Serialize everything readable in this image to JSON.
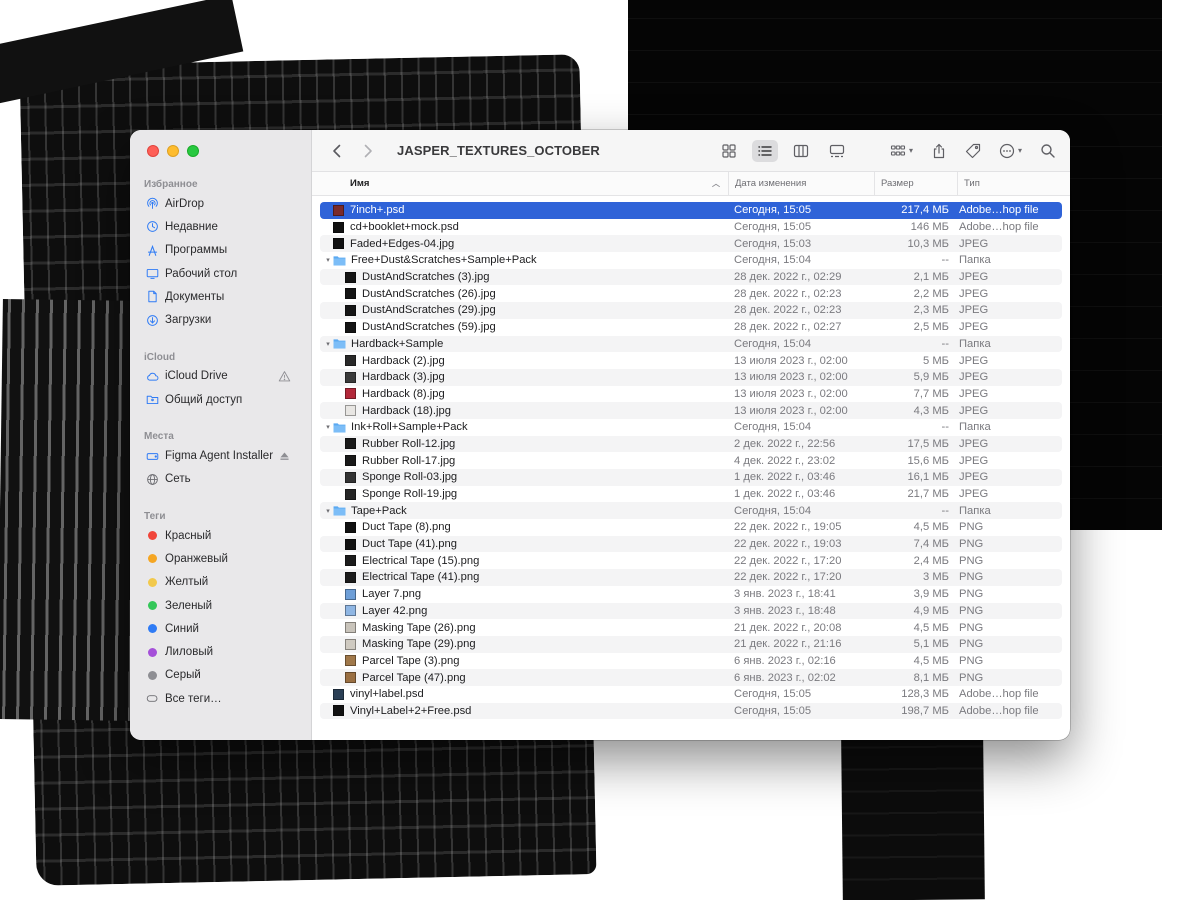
{
  "window": {
    "title": "JASPER_TEXTURES_OCTOBER"
  },
  "sidebar": {
    "sections": [
      {
        "header": "Избранное",
        "items": [
          {
            "label": "AirDrop",
            "icon": "airdrop-icon"
          },
          {
            "label": "Недавние",
            "icon": "clock-icon"
          },
          {
            "label": "Программы",
            "icon": "apps-icon"
          },
          {
            "label": "Рабочий стол",
            "icon": "desktop-icon"
          },
          {
            "label": "Документы",
            "icon": "document-icon"
          },
          {
            "label": "Загрузки",
            "icon": "download-icon"
          }
        ]
      },
      {
        "header": "iCloud",
        "items": [
          {
            "label": "iCloud Drive",
            "icon": "cloud-icon",
            "trailing": "warning-icon"
          },
          {
            "label": "Общий доступ",
            "icon": "shared-folder-icon"
          }
        ]
      },
      {
        "header": "Места",
        "items": [
          {
            "label": "Figma Agent Installer",
            "icon": "drive-icon",
            "trailing": "eject-icon"
          },
          {
            "label": "Сеть",
            "icon": "globe-icon"
          }
        ]
      },
      {
        "header": "Теги",
        "items": [
          {
            "label": "Красный",
            "color": "#f0453a"
          },
          {
            "label": "Оранжевый",
            "color": "#f5a623"
          },
          {
            "label": "Желтый",
            "color": "#f2c94c"
          },
          {
            "label": "Зеленый",
            "color": "#34c759"
          },
          {
            "label": "Синий",
            "color": "#2f7bf5"
          },
          {
            "label": "Лиловый",
            "color": "#a550d9"
          },
          {
            "label": "Серый",
            "color": "#8e8e93"
          },
          {
            "label": "Все теги…",
            "icon": "all-tags-icon"
          }
        ]
      }
    ]
  },
  "columns": {
    "name": "Имя",
    "date": "Дата изменения",
    "size": "Размер",
    "kind": "Тип"
  },
  "files": [
    {
      "name": "7inch+.psd",
      "date": "Сегодня, 15:05",
      "size": "217,4 МБ",
      "kind": "Adobe…hop file",
      "level": 0,
      "type": "file",
      "thumb": "#7a2a2a",
      "selected": true
    },
    {
      "name": "cd+booklet+mock.psd",
      "date": "Сегодня, 15:05",
      "size": "146 МБ",
      "kind": "Adobe…hop file",
      "level": 0,
      "type": "file",
      "thumb": "#111111"
    },
    {
      "name": "Faded+Edges-04.jpg",
      "date": "Сегодня, 15:03",
      "size": "10,3 МБ",
      "kind": "JPEG",
      "level": 0,
      "type": "file",
      "thumb": "#111111"
    },
    {
      "name": "Free+Dust&Scratches+Sample+Pack",
      "date": "Сегодня, 15:04",
      "size": "--",
      "kind": "Папка",
      "level": 0,
      "type": "folder"
    },
    {
      "name": "DustAndScratches (3).jpg",
      "date": "28 дек. 2022 г., 02:29",
      "size": "2,1 МБ",
      "kind": "JPEG",
      "level": 1,
      "type": "file",
      "thumb": "#151515"
    },
    {
      "name": "DustAndScratches (26).jpg",
      "date": "28 дек. 2022 г., 02:23",
      "size": "2,2 МБ",
      "kind": "JPEG",
      "level": 1,
      "type": "file",
      "thumb": "#151515"
    },
    {
      "name": "DustAndScratches (29).jpg",
      "date": "28 дек. 2022 г., 02:23",
      "size": "2,3 МБ",
      "kind": "JPEG",
      "level": 1,
      "type": "file",
      "thumb": "#151515"
    },
    {
      "name": "DustAndScratches (59).jpg",
      "date": "28 дек. 2022 г., 02:27",
      "size": "2,5 МБ",
      "kind": "JPEG",
      "level": 1,
      "type": "file",
      "thumb": "#151515"
    },
    {
      "name": "Hardback+Sample",
      "date": "Сегодня, 15:04",
      "size": "--",
      "kind": "Папка",
      "level": 0,
      "type": "folder"
    },
    {
      "name": "Hardback (2).jpg",
      "date": "13 июля 2023 г., 02:00",
      "size": "5 МБ",
      "kind": "JPEG",
      "level": 1,
      "type": "file",
      "thumb": "#2a2a2a"
    },
    {
      "name": "Hardback (3).jpg",
      "date": "13 июля 2023 г., 02:00",
      "size": "5,9 МБ",
      "kind": "JPEG",
      "level": 1,
      "type": "file",
      "thumb": "#3a3a3a"
    },
    {
      "name": "Hardback (8).jpg",
      "date": "13 июля 2023 г., 02:00",
      "size": "7,7 МБ",
      "kind": "JPEG",
      "level": 1,
      "type": "file",
      "thumb": "#b3283a"
    },
    {
      "name": "Hardback (18).jpg",
      "date": "13 июля 2023 г., 02:00",
      "size": "4,3 МБ",
      "kind": "JPEG",
      "level": 1,
      "type": "file",
      "thumb": "#e8e6e3"
    },
    {
      "name": "Ink+Roll+Sample+Pack",
      "date": "Сегодня, 15:04",
      "size": "--",
      "kind": "Папка",
      "level": 0,
      "type": "folder"
    },
    {
      "name": "Rubber Roll-12.jpg",
      "date": "2 дек. 2022 г., 22:56",
      "size": "17,5 МБ",
      "kind": "JPEG",
      "level": 1,
      "type": "file",
      "thumb": "#1a1a1a"
    },
    {
      "name": "Rubber Roll-17.jpg",
      "date": "4 дек. 2022 г., 23:02",
      "size": "15,6 МБ",
      "kind": "JPEG",
      "level": 1,
      "type": "file",
      "thumb": "#1a1a1a"
    },
    {
      "name": "Sponge Roll-03.jpg",
      "date": "1 дек. 2022 г., 03:46",
      "size": "16,1 МБ",
      "kind": "JPEG",
      "level": 1,
      "type": "file",
      "thumb": "#333333"
    },
    {
      "name": "Sponge Roll-19.jpg",
      "date": "1 дек. 2022 г., 03:46",
      "size": "21,7 МБ",
      "kind": "JPEG",
      "level": 1,
      "type": "file",
      "thumb": "#262626"
    },
    {
      "name": "Tape+Pack",
      "date": "Сегодня, 15:04",
      "size": "--",
      "kind": "Папка",
      "level": 0,
      "type": "folder"
    },
    {
      "name": "Duct Tape (8).png",
      "date": "22 дек. 2022 г., 19:05",
      "size": "4,5 МБ",
      "kind": "PNG",
      "level": 1,
      "type": "file",
      "thumb": "#111111"
    },
    {
      "name": "Duct Tape (41).png",
      "date": "22 дек. 2022 г., 19:03",
      "size": "7,4 МБ",
      "kind": "PNG",
      "level": 1,
      "type": "file",
      "thumb": "#111111"
    },
    {
      "name": "Electrical Tape (15).png",
      "date": "22 дек. 2022 г., 17:20",
      "size": "2,4 МБ",
      "kind": "PNG",
      "level": 1,
      "type": "file",
      "thumb": "#1c1c1c"
    },
    {
      "name": "Electrical Tape (41).png",
      "date": "22 дек. 2022 г., 17:20",
      "size": "3 МБ",
      "kind": "PNG",
      "level": 1,
      "type": "file",
      "thumb": "#1c1c1c"
    },
    {
      "name": "Layer 7.png",
      "date": "3 янв. 2023 г., 18:41",
      "size": "3,9 МБ",
      "kind": "PNG",
      "level": 1,
      "type": "file",
      "thumb": "#6e9fd8"
    },
    {
      "name": "Layer 42.png",
      "date": "3 янв. 2023 г., 18:48",
      "size": "4,9 МБ",
      "kind": "PNG",
      "level": 1,
      "type": "file",
      "thumb": "#8fb6e3"
    },
    {
      "name": "Masking Tape (26).png",
      "date": "21 дек. 2022 г., 20:08",
      "size": "4,5 МБ",
      "kind": "PNG",
      "level": 1,
      "type": "file",
      "thumb": "#c9c4bb"
    },
    {
      "name": "Masking Tape (29).png",
      "date": "21 дек. 2022 г., 21:16",
      "size": "5,1 МБ",
      "kind": "PNG",
      "level": 1,
      "type": "file",
      "thumb": "#cfcac1"
    },
    {
      "name": "Parcel Tape (3).png",
      "date": "6 янв. 2023 г., 02:16",
      "size": "4,5 МБ",
      "kind": "PNG",
      "level": 1,
      "type": "file",
      "thumb": "#a0784a"
    },
    {
      "name": "Parcel Tape (47).png",
      "date": "6 янв. 2023 г., 02:02",
      "size": "8,1 МБ",
      "kind": "PNG",
      "level": 1,
      "type": "file",
      "thumb": "#9a6f42"
    },
    {
      "name": "vinyl+label.psd",
      "date": "Сегодня, 15:05",
      "size": "128,3 МБ",
      "kind": "Adobe…hop file",
      "level": 0,
      "type": "file",
      "thumb": "#2a3f55"
    },
    {
      "name": "Vinyl+Label+2+Free.psd",
      "date": "Сегодня, 15:05",
      "size": "198,7 МБ",
      "kind": "Adobe…hop file",
      "level": 0,
      "type": "file",
      "thumb": "#111111"
    }
  ],
  "colors": {
    "selection": "#2f63d8",
    "folder": "#5aa9f2"
  }
}
